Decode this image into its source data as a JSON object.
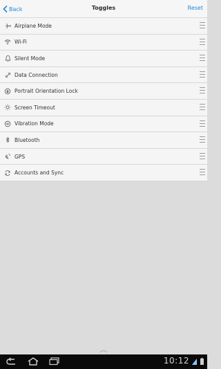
{
  "header": {
    "back_label": "Back",
    "title": "Toggles",
    "reset_label": "Reset"
  },
  "toggles": [
    {
      "label": "Airplane Mode",
      "icon": "airplane-icon"
    },
    {
      "label": "Wi-Fi",
      "icon": "wifi-icon"
    },
    {
      "label": "Silent Mode",
      "icon": "bell-icon"
    },
    {
      "label": "Data Connection",
      "icon": "data-connection-icon"
    },
    {
      "label": "Portrait Orientation Lock",
      "icon": "orientation-lock-icon"
    },
    {
      "label": "Screen Timeout",
      "icon": "brightness-icon"
    },
    {
      "label": "Vibration Mode",
      "icon": "vibration-icon"
    },
    {
      "label": "Bluetooth",
      "icon": "bluetooth-icon"
    },
    {
      "label": "GPS",
      "icon": "gps-icon"
    },
    {
      "label": "Accounts and Sync",
      "icon": "sync-icon"
    }
  ],
  "status_bar": {
    "time": "10:12"
  },
  "colors": {
    "accent": "#1e88d8",
    "list_background": "#f5f5f5",
    "empty_background": "#dcdcdc",
    "nav_background": "#0a0a0a"
  }
}
